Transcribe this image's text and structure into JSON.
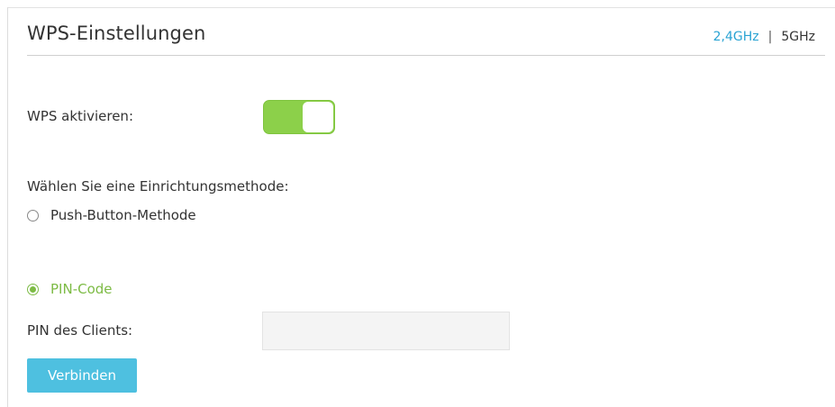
{
  "header": {
    "title": "WPS-Einstellungen",
    "band_tabs": {
      "active": "2,4GHz",
      "separator": "|",
      "inactive": "5GHz"
    }
  },
  "wps": {
    "enable_label": "WPS aktivieren:",
    "enabled": true
  },
  "method": {
    "prompt": "Wählen Sie eine Einrichtungsmethode:",
    "options": [
      {
        "label": "Push-Button-Methode",
        "selected": false
      },
      {
        "label": "PIN-Code",
        "selected": true
      }
    ]
  },
  "pin": {
    "label": "PIN des Clients:",
    "value": "",
    "placeholder": ""
  },
  "actions": {
    "connect_label": "Verbinden"
  },
  "colors": {
    "accent_green": "#8cd04a",
    "radio_green": "#7dbb45",
    "link_blue": "#29a3d3",
    "button_blue": "#4ec0e0"
  }
}
